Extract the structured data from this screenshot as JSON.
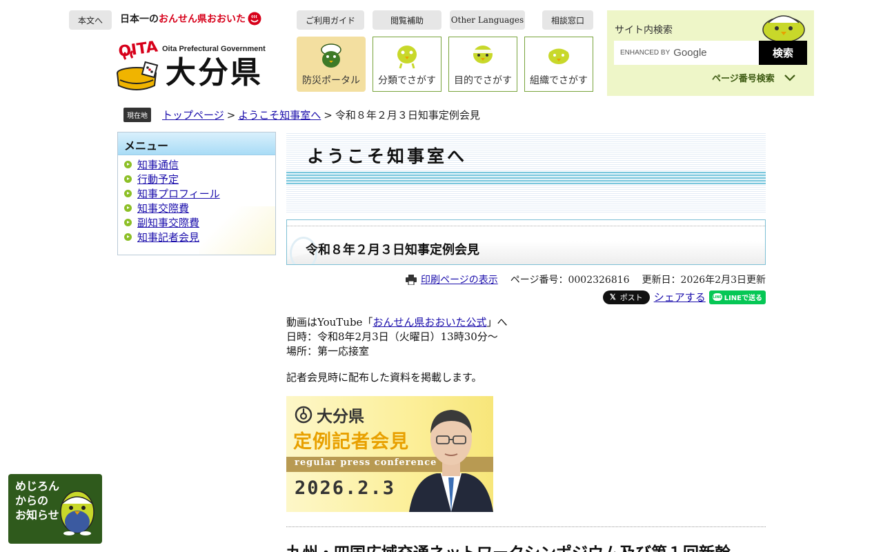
{
  "header": {
    "skip_link": "本文へ",
    "tagline_prefix": "日本一の",
    "tagline_red": "おんせん県",
    "tagline_suffix": "おおいた",
    "logo_eng": "Oita Prefectural Government",
    "logo_jp": "大分県",
    "logo_mark": "OITA",
    "utility_links": [
      "ご利用ガイド",
      "閲覧補助",
      "Other Languages",
      "相談窓口"
    ],
    "nav_tiles": [
      "防災ポータル",
      "分類でさがす",
      "目的でさがす",
      "組織でさがす"
    ]
  },
  "search": {
    "title": "サイト内検索",
    "enhanced_by": "ENHANCED BY",
    "google": "Google",
    "button": "検索",
    "page_no_search": "ページ番号検索"
  },
  "breadcrumb": {
    "badge": "現在地",
    "items": [
      "トップページ",
      "ようこそ知事室へ"
    ],
    "current": "令和８年２月３日知事定例会見",
    "separator": ">"
  },
  "sidebar": {
    "heading": "メニュー",
    "items": [
      "知事通信",
      "行動予定",
      "知事プロフィール",
      "知事交際費",
      "副知事交際費",
      "知事記者会見"
    ]
  },
  "main": {
    "section_title": "ようこそ知事室へ",
    "page_title": "令和８年２月３日知事定例会見",
    "print_link": "印刷ページの表示",
    "page_number": "ページ番号：0002326816",
    "updated": "更新日：2026年2月3日更新",
    "share": {
      "x_label": "ポスト",
      "x_mark": "𝕏",
      "share_link": "シェアする",
      "line_label": "LINEで送る",
      "line_bubble": "LINE"
    },
    "video_prefix": "動画はYouTube「",
    "video_link": "おんせん県おおいた公式",
    "video_suffix": "」へ",
    "datetime": "日時：令和8年2月3日（火曜日）13時30分～",
    "place": "場所：第一応接室",
    "materials": "記者会見時に配布した資料を掲載します。",
    "thumbnail": {
      "logo": "大分県",
      "title": "定例記者会見",
      "english": "regular press conference",
      "date": "2026.2.3"
    },
    "next_heading": "九州・四国広域交通ネットワークシンポジウム及び第１回新幹"
  },
  "notice": {
    "text": "めじろん\nからの\nお知らせ"
  },
  "colors": {
    "accent_green": "#77a33a",
    "search_bg": "#eef6c8",
    "portal_bg": "#f3dfa0",
    "notice_bg": "#2f5a1c"
  }
}
